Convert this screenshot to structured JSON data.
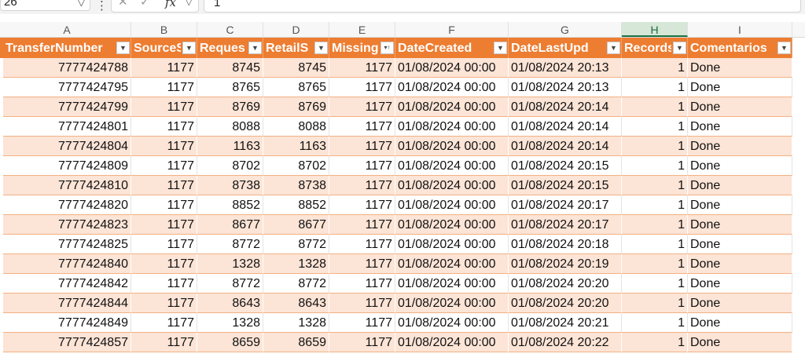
{
  "formula_bar": {
    "name_box": "26",
    "separator": "⋮",
    "cancel_icon": "✕",
    "confirm_icon": "✓",
    "fx_label": "fx",
    "formula_value": "1"
  },
  "column_letters": [
    "A",
    "B",
    "C",
    "D",
    "E",
    "F",
    "G",
    "H",
    "I"
  ],
  "selected_column": "H",
  "table": {
    "accent_color": "#ed7d31",
    "band_color": "#fce4d6",
    "headers": [
      {
        "label": "TransferNumber",
        "filter": "dropdown"
      },
      {
        "label": "SourceS",
        "filter": "dropdown"
      },
      {
        "label": "Reques",
        "filter": "dropdown"
      },
      {
        "label": "RetailS",
        "filter": "dropdown"
      },
      {
        "label": "Missing",
        "filter": "sorted"
      },
      {
        "label": "DateCreated",
        "filter": "dropdown"
      },
      {
        "label": "DateLastUpd",
        "filter": "dropdown"
      },
      {
        "label": "Records",
        "filter": "dropdown"
      },
      {
        "label": "Comentarios",
        "filter": "dropdown"
      }
    ],
    "rows": [
      [
        "7777424788",
        "1177",
        "8745",
        "8745",
        "1177",
        "01/08/2024 00:00",
        "01/08/2024 20:13",
        "1",
        "Done"
      ],
      [
        "7777424795",
        "1177",
        "8765",
        "8765",
        "1177",
        "01/08/2024 00:00",
        "01/08/2024 20:13",
        "1",
        "Done"
      ],
      [
        "7777424799",
        "1177",
        "8769",
        "8769",
        "1177",
        "01/08/2024 00:00",
        "01/08/2024 20:14",
        "1",
        "Done"
      ],
      [
        "7777424801",
        "1177",
        "8088",
        "8088",
        "1177",
        "01/08/2024 00:00",
        "01/08/2024 20:14",
        "1",
        "Done"
      ],
      [
        "7777424804",
        "1177",
        "1163",
        "1163",
        "1177",
        "01/08/2024 00:00",
        "01/08/2024 20:14",
        "1",
        "Done"
      ],
      [
        "7777424809",
        "1177",
        "8702",
        "8702",
        "1177",
        "01/08/2024 00:00",
        "01/08/2024 20:15",
        "1",
        "Done"
      ],
      [
        "7777424810",
        "1177",
        "8738",
        "8738",
        "1177",
        "01/08/2024 00:00",
        "01/08/2024 20:15",
        "1",
        "Done"
      ],
      [
        "7777424820",
        "1177",
        "8852",
        "8852",
        "1177",
        "01/08/2024 00:00",
        "01/08/2024 20:17",
        "1",
        "Done"
      ],
      [
        "7777424823",
        "1177",
        "8677",
        "8677",
        "1177",
        "01/08/2024 00:00",
        "01/08/2024 20:17",
        "1",
        "Done"
      ],
      [
        "7777424825",
        "1177",
        "8772",
        "8772",
        "1177",
        "01/08/2024 00:00",
        "01/08/2024 20:18",
        "1",
        "Done"
      ],
      [
        "7777424840",
        "1177",
        "1328",
        "1328",
        "1177",
        "01/08/2024 00:00",
        "01/08/2024 20:19",
        "1",
        "Done"
      ],
      [
        "7777424842",
        "1177",
        "8772",
        "8772",
        "1177",
        "01/08/2024 00:00",
        "01/08/2024 20:20",
        "1",
        "Done"
      ],
      [
        "7777424844",
        "1177",
        "8643",
        "8643",
        "1177",
        "01/08/2024 00:00",
        "01/08/2024 20:20",
        "1",
        "Done"
      ],
      [
        "7777424849",
        "1177",
        "1328",
        "1328",
        "1177",
        "01/08/2024 00:00",
        "01/08/2024 20:21",
        "1",
        "Done"
      ],
      [
        "7777424857",
        "1177",
        "8659",
        "8659",
        "1177",
        "01/08/2024 00:00",
        "01/08/2024 20:22",
        "1",
        "Done"
      ]
    ]
  }
}
